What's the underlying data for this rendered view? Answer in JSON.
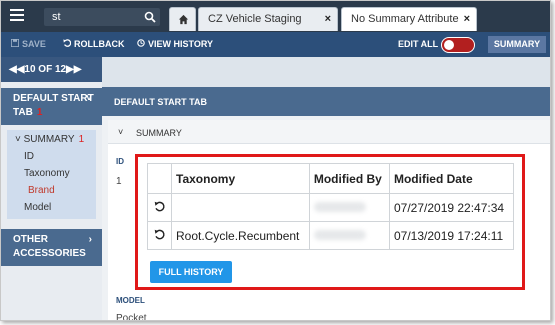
{
  "search": {
    "value": "st"
  },
  "tabs": [
    {
      "label": "CZ Vehicle Staging",
      "close": "×"
    },
    {
      "label": "No Summary Attribute",
      "close": "×"
    }
  ],
  "toolbar": {
    "save": "SAVE",
    "rollback": "ROLLBACK",
    "view_history": "VIEW HISTORY",
    "edit_all": "EDIT ALL",
    "summary": "SUMMARY"
  },
  "sidebar": {
    "pager": "10 OF 12",
    "default_start_tab": "DEFAULT START TAB",
    "default_start_tab_count": "1",
    "items": [
      {
        "label": "SUMMARY",
        "count": "1"
      },
      {
        "label": "ID"
      },
      {
        "label": "Taxonomy"
      },
      {
        "label": "Brand"
      },
      {
        "label": "Model"
      }
    ],
    "other_accessories": "OTHER ACCESSORIES"
  },
  "main": {
    "header": "DEFAULT START TAB",
    "section": "SUMMARY",
    "bg_labels": {
      "id": "ID",
      "model": "MODEL",
      "model_value": "Pocket",
      "id_value": "1"
    }
  },
  "history": {
    "columns": [
      "Taxonomy",
      "Modified By",
      "Modified Date"
    ],
    "rows": [
      {
        "taxonomy": "",
        "modified_date": "07/27/2019 22:47:34"
      },
      {
        "taxonomy": "Root.Cycle.Recumbent",
        "modified_date": "07/13/2019 17:24:11"
      }
    ],
    "full_history": "FULL HISTORY"
  },
  "colors": {
    "topbar": "#2b3a4b",
    "toolbar": "#2c4f7a",
    "section": "#4a6a8f",
    "highlight_border": "#e01818",
    "full_history_button": "#2196e8",
    "toggle": "#b21f1f"
  }
}
